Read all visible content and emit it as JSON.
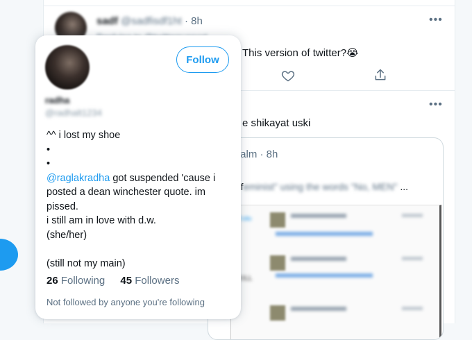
{
  "tweet1": {
    "name": "sadf",
    "handle": "@sadfisdf1ht",
    "time": "8h",
    "replying": "Replying to @twittersupport",
    "text": "This version of twitter?😭"
  },
  "tweet2": {
    "text": "e shikayat uski",
    "quoted": {
      "handle_time": "tionalm · 8h",
      "text_prefix": "d \"f",
      "text_blurred": "eminist\" using the words \"No, MEN\"",
      "text_suffix": "..."
    },
    "embed_labels": [
      "Follo",
      "KILL"
    ]
  },
  "profile_card": {
    "name": "radha",
    "handle": "@radhalt1234",
    "follow_label": "Follow",
    "bio_lines": [
      "^^ i lost my shoe",
      "•",
      "•"
    ],
    "mention": "@raglakradha",
    "mention_suffix": " got suspended 'cause i",
    "bio_lines_2": [
      "posted a dean winchester quote. im",
      "pissed.",
      "i still am in love with d.w.",
      "(she/her)",
      "",
      "(still not my main)"
    ],
    "following_count": "26",
    "following_label": "Following",
    "followers_count": "45",
    "followers_label": "Followers",
    "not_followed_text": "Not followed by anyone you're following"
  },
  "icons": {
    "more": "more-icon",
    "like": "heart-icon",
    "share": "share-icon"
  },
  "colors": {
    "accent": "#1d9bf0",
    "text": "#0f1419",
    "secondary": "#5b7083",
    "border": "#e6ecf0"
  }
}
